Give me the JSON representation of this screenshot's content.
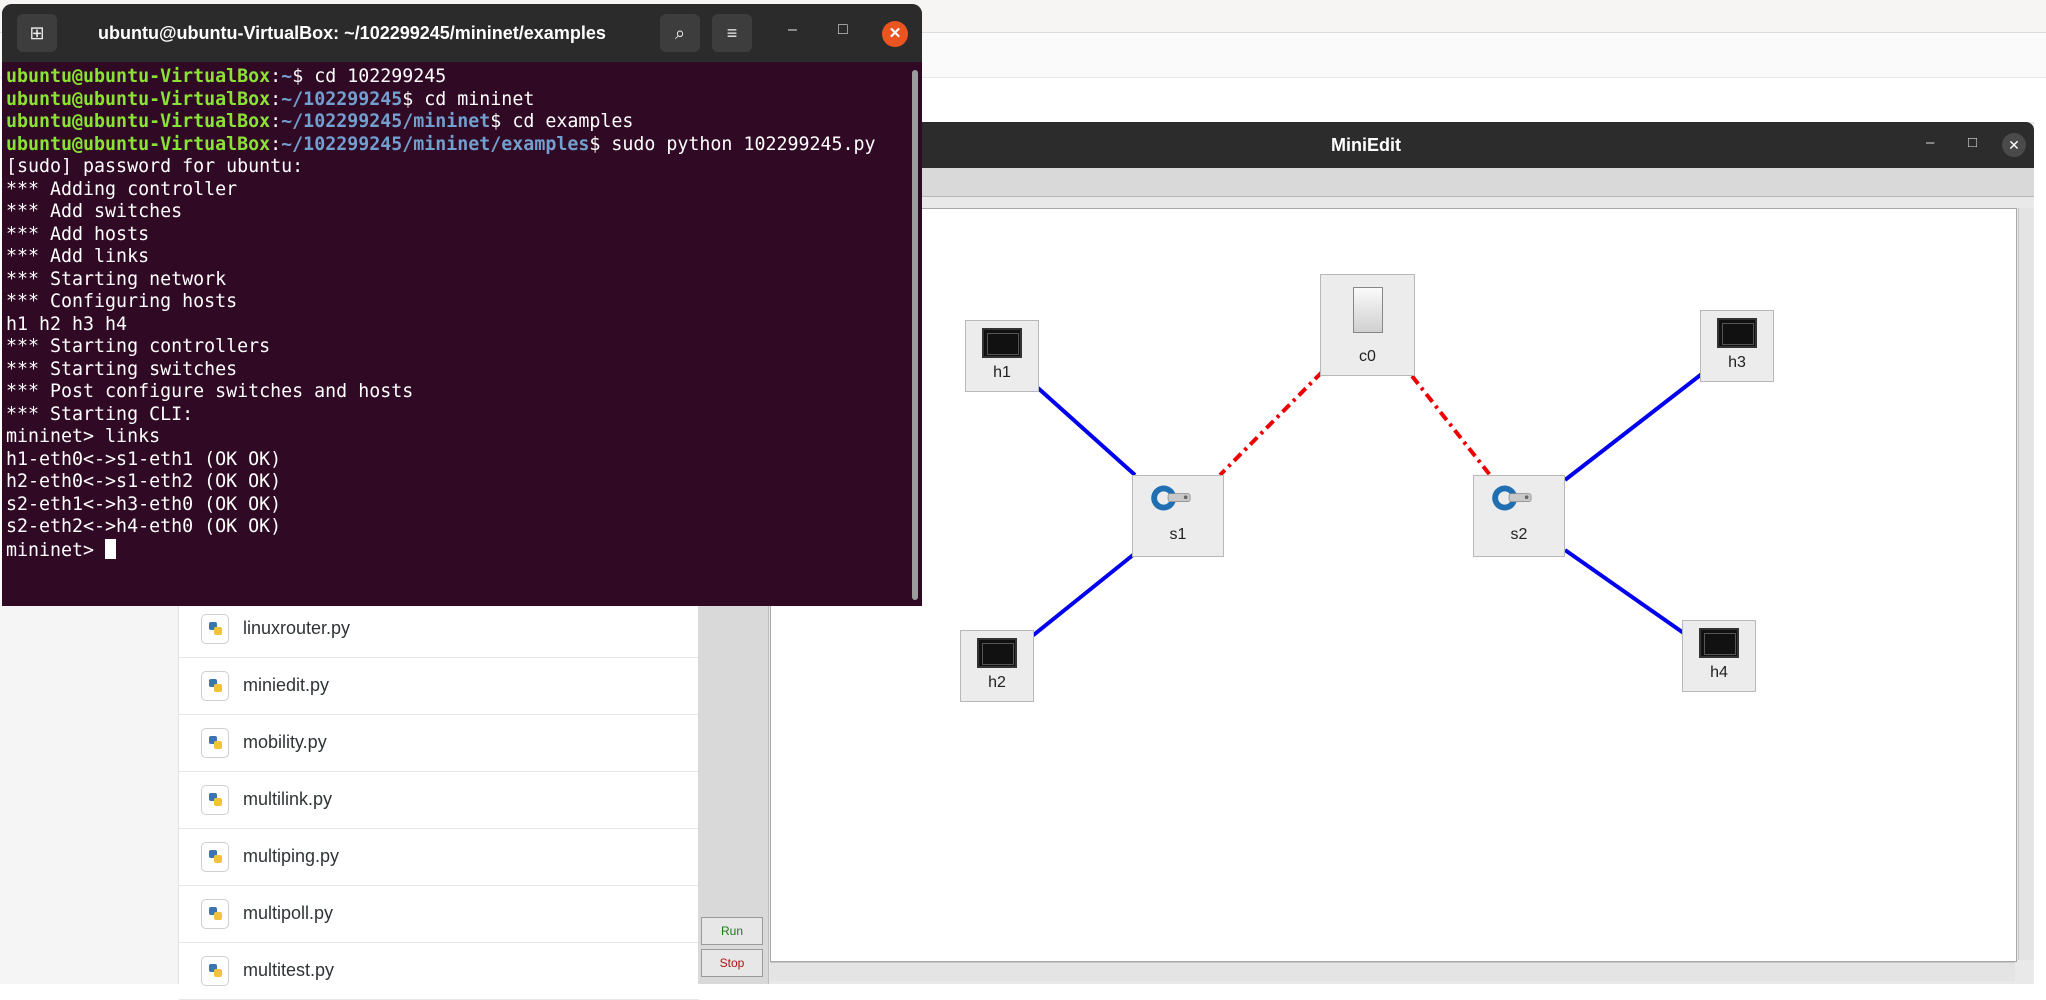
{
  "file_manager": {
    "files": [
      "linuxrouter.py",
      "miniedit.py",
      "mobility.py",
      "multilink.py",
      "multiping.py",
      "multipoll.py",
      "multitest.py"
    ]
  },
  "miniedit": {
    "title": "MiniEdit",
    "run_label": "Run",
    "stop_label": "Stop",
    "nodes": {
      "h1": "h1",
      "h2": "h2",
      "h3": "h3",
      "h4": "h4",
      "s1": "s1",
      "s2": "s2",
      "c0": "c0"
    },
    "colors": {
      "host_link": "#0000ee",
      "controller_link": "#ee0000",
      "run_text": "#1a7a1a",
      "stop_text": "#b01010"
    }
  },
  "terminal": {
    "title": "ubuntu@ubuntu-VirtualBox: ~/102299245/mininet/examples",
    "prompt_user": "ubuntu@ubuntu-VirtualBox",
    "commands": [
      {
        "path": "~",
        "cmd": "cd 102299245"
      },
      {
        "path": "~/102299245",
        "cmd": "cd mininet"
      },
      {
        "path": "~/102299245/mininet",
        "cmd": "cd examples"
      },
      {
        "path": "~/102299245/mininet/examples",
        "cmd": "sudo python 102299245.py"
      }
    ],
    "output": [
      "[sudo] password for ubuntu:",
      "*** Adding controller",
      "*** Add switches",
      "*** Add hosts",
      "*** Add links",
      "*** Starting network",
      "*** Configuring hosts",
      "h1 h2 h3 h4",
      "*** Starting controllers",
      "*** Starting switches",
      "*** Post configure switches and hosts",
      "*** Starting CLI:",
      "mininet> links",
      "h1-eth0<->s1-eth1 (OK OK)",
      "h2-eth0<->s1-eth2 (OK OK)",
      "s2-eth1<->h3-eth0 (OK OK)",
      "s2-eth2<->h4-eth0 (OK OK)"
    ],
    "final_prompt": "mininet> "
  }
}
